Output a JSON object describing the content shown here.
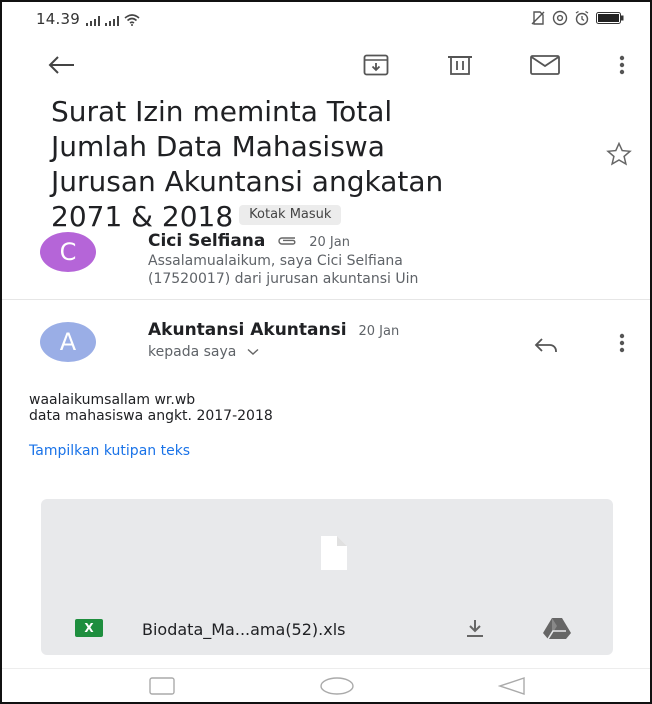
{
  "status_bar": {
    "time": "14.39",
    "left_icons": [
      "signal-icon",
      "signal-icon",
      "wifi-icon"
    ],
    "right_icons": [
      "no-sim-icon",
      "at-icon",
      "alarm-icon",
      "battery-icon"
    ]
  },
  "toolbar": {
    "icons": [
      "back-arrow-icon",
      "archive-icon",
      "delete-icon",
      "mark-unread-icon",
      "more-vert-icon"
    ]
  },
  "email": {
    "subject_lines": [
      "Surat Izin meminta Total",
      "Jumlah Data Mahasiswa",
      "Jurusan Akuntansi angkatan",
      "2071 & 2018"
    ],
    "label": "Kotak Masuk"
  },
  "messages": [
    {
      "avatar_letter": "C",
      "avatar_color": "#b565d8",
      "sender": "Cici Selfiana",
      "date": "20 Jan",
      "snippet_lines": [
        "Assalamualaikum, saya Cici Selfiana",
        "(17520017) dari jurusan akuntansi Uin"
      ]
    },
    {
      "avatar_letter": "A",
      "avatar_color": "#9aaee6",
      "sender": "Akuntansi Akuntansi",
      "date": "20 Jan",
      "recipient": "kepada saya",
      "body_lines": [
        "waalaikumsallam wr.wb",
        "data mahasiswa angkt. 2017-2018"
      ],
      "quote_toggle": "Tampilkan kutipan teks",
      "attachment": {
        "icon_letter": "X",
        "file_name": "Biodata_Ma...ama(52).xls"
      }
    }
  ],
  "colors": {
    "link": "#1a73e8",
    "excel": "#1e8e3e"
  }
}
